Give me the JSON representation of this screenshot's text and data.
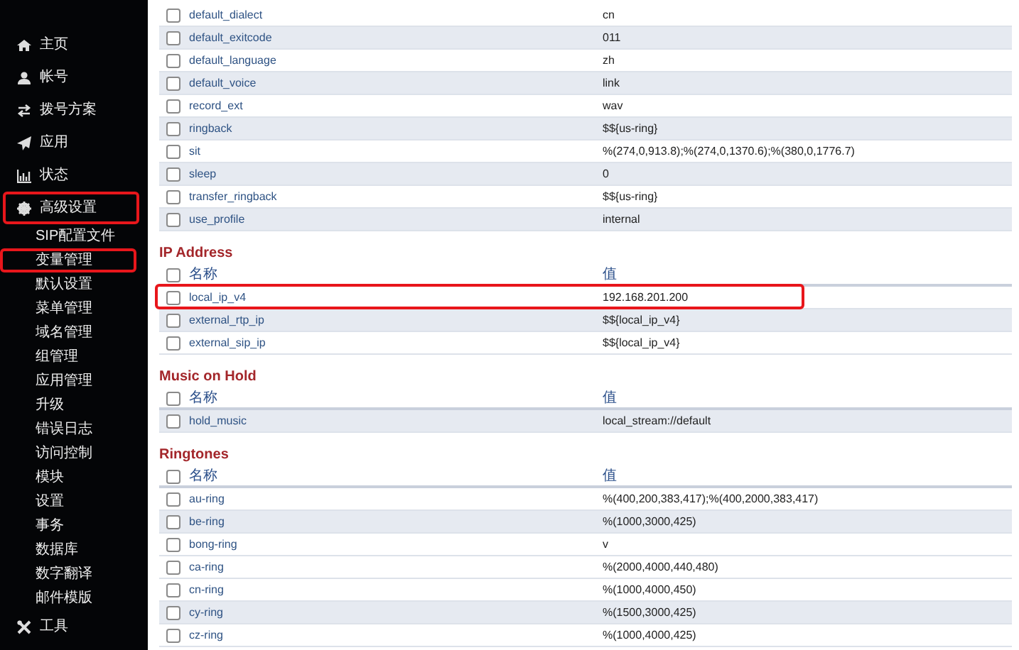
{
  "sidebar": {
    "items": [
      {
        "label": "主页",
        "highlighted": false
      },
      {
        "label": "帐号",
        "highlighted": false
      },
      {
        "label": "拨号方案",
        "highlighted": false
      },
      {
        "label": "应用",
        "highlighted": false
      },
      {
        "label": "状态",
        "highlighted": false
      },
      {
        "label": "高级设置",
        "highlighted": true,
        "children": [
          {
            "label": "SIP配置文件",
            "highlighted": false
          },
          {
            "label": "变量管理",
            "highlighted": true
          },
          {
            "label": "默认设置",
            "highlighted": false
          },
          {
            "label": "菜单管理",
            "highlighted": false
          },
          {
            "label": "域名管理",
            "highlighted": false
          },
          {
            "label": "组管理",
            "highlighted": false
          },
          {
            "label": "应用管理",
            "highlighted": false
          },
          {
            "label": "升级",
            "highlighted": false
          },
          {
            "label": "错误日志",
            "highlighted": false
          },
          {
            "label": "访问控制",
            "highlighted": false
          },
          {
            "label": "模块",
            "highlighted": false
          },
          {
            "label": "设置",
            "highlighted": false
          },
          {
            "label": "事务",
            "highlighted": false
          },
          {
            "label": "数据库",
            "highlighted": false
          },
          {
            "label": "数字翻译",
            "highlighted": false
          },
          {
            "label": "邮件模版",
            "highlighted": false
          }
        ]
      },
      {
        "label": "工具",
        "highlighted": false
      }
    ]
  },
  "sections": [
    {
      "rows": [
        {
          "name": "default_dialect",
          "value": "cn",
          "checked": false,
          "shaded": false,
          "highlighted": false
        },
        {
          "name": "default_exitcode",
          "value": "011",
          "checked": false,
          "shaded": true,
          "highlighted": false
        },
        {
          "name": "default_language",
          "value": "zh",
          "checked": false,
          "shaded": false,
          "highlighted": false
        },
        {
          "name": "default_voice",
          "value": "link",
          "checked": false,
          "shaded": true,
          "highlighted": false
        },
        {
          "name": "record_ext",
          "value": "wav",
          "checked": false,
          "shaded": false,
          "highlighted": false
        },
        {
          "name": "ringback",
          "value": "$${us-ring}",
          "checked": false,
          "shaded": true,
          "highlighted": false
        },
        {
          "name": "sit",
          "value": "%(274,0,913.8);%(274,0,1370.6);%(380,0,1776.7)",
          "checked": false,
          "shaded": false,
          "highlighted": false
        },
        {
          "name": "sleep",
          "value": "0",
          "checked": false,
          "shaded": true,
          "highlighted": false
        },
        {
          "name": "transfer_ringback",
          "value": "$${us-ring}",
          "checked": false,
          "shaded": false,
          "highlighted": false
        },
        {
          "name": "use_profile",
          "value": "internal",
          "checked": false,
          "shaded": true,
          "highlighted": false
        }
      ]
    },
    {
      "title": "IP Address",
      "columns": {
        "checked": false,
        "name": "名称",
        "value": "值"
      },
      "rows": [
        {
          "name": "local_ip_v4",
          "value": "192.168.201.200",
          "checked": false,
          "shaded": false,
          "highlighted": true
        },
        {
          "name": "external_rtp_ip",
          "value": "$${local_ip_v4}",
          "checked": false,
          "shaded": true,
          "highlighted": false
        },
        {
          "name": "external_sip_ip",
          "value": "$${local_ip_v4}",
          "checked": false,
          "shaded": false,
          "highlighted": false
        }
      ]
    },
    {
      "title": "Music on Hold",
      "columns": {
        "checked": false,
        "name": "名称",
        "value": "值"
      },
      "rows": [
        {
          "name": "hold_music",
          "value": "local_stream://default",
          "checked": false,
          "shaded": true,
          "highlighted": false
        }
      ]
    },
    {
      "title": "Ringtones",
      "columns": {
        "checked": false,
        "name": "名称",
        "value": "值"
      },
      "rows": [
        {
          "name": "au-ring",
          "value": "%(400,200,383,417);%(400,2000,383,417)",
          "checked": false,
          "shaded": false,
          "highlighted": false
        },
        {
          "name": "be-ring",
          "value": "%(1000,3000,425)",
          "checked": false,
          "shaded": true,
          "highlighted": false
        },
        {
          "name": "bong-ring",
          "value": "v",
          "checked": false,
          "shaded": false,
          "highlighted": false
        },
        {
          "name": "ca-ring",
          "value": "%(2000,4000,440,480)",
          "checked": false,
          "shaded": false,
          "highlighted": false
        },
        {
          "name": "cn-ring",
          "value": "%(1000,4000,450)",
          "checked": false,
          "shaded": false,
          "highlighted": false
        },
        {
          "name": "cy-ring",
          "value": "%(1500,3000,425)",
          "checked": false,
          "shaded": true,
          "highlighted": false
        },
        {
          "name": "cz-ring",
          "value": "%(1000,4000,425)",
          "checked": false,
          "shaded": false,
          "highlighted": false
        }
      ]
    }
  ]
}
